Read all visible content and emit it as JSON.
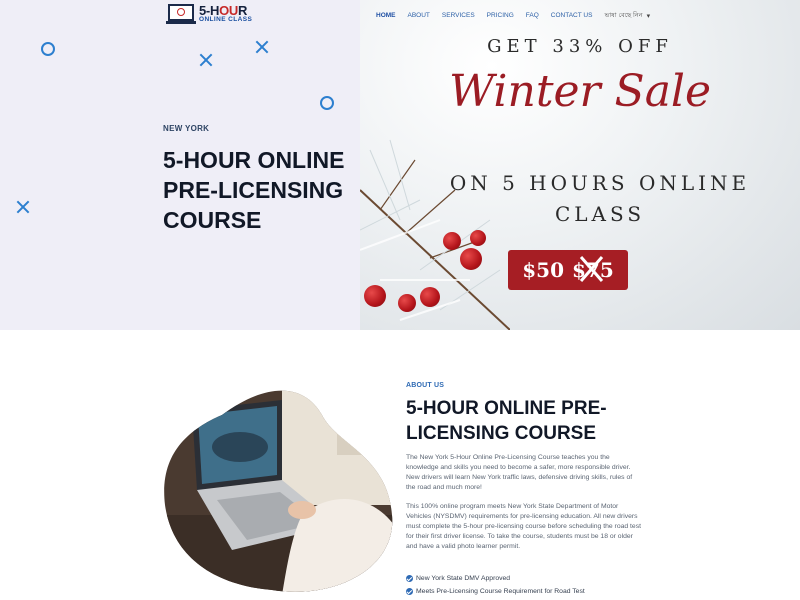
{
  "logo": {
    "top_main": "5-H",
    "top_accent": "OU",
    "top_tail": "R",
    "bottom": "ONLINE CLASS"
  },
  "nav": {
    "items": [
      "HOME",
      "ABOUT",
      "SERVICES",
      "PRICING",
      "FAQ",
      "CONTACT US"
    ],
    "language": "ভাষা বেছে নিন"
  },
  "hero": {
    "kicker": "NEW YORK",
    "title": "5-HOUR ONLINE PRE-LICENSING COURSE"
  },
  "promo": {
    "line1": "GET 33% OFF",
    "script": "Winter Sale",
    "line2": "ON 5 HOURS ONLINE CLASS",
    "price_new": "$50",
    "price_old": "$75"
  },
  "about": {
    "kicker": "ABOUT US",
    "title": "5-HOUR ONLINE PRE-LICENSING COURSE",
    "p1": "The New York 5-Hour Online Pre-Licensing Course teaches you the knowledge and skills you need to become a safer, more responsible driver. New drivers will learn New York traffic laws, defensive driving skills, rules of the road and much more!",
    "p2": "This 100% online program meets New York State Department of Motor Vehicles (NYSDMV) requirements for pre-licensing education. All new drivers must complete the 5-hour pre-licensing course before scheduling the road test for their first driver license. To take the course, students must be 18 or older and have a valid photo learner permit.",
    "checks": [
      "New York State DMV Approved",
      "Meets Pre-Licensing Course Requirement for Road Test"
    ]
  },
  "colors": {
    "accent": "#2e6ab4",
    "sale_red": "#a61e24",
    "hero_bg": "#efeef7"
  }
}
